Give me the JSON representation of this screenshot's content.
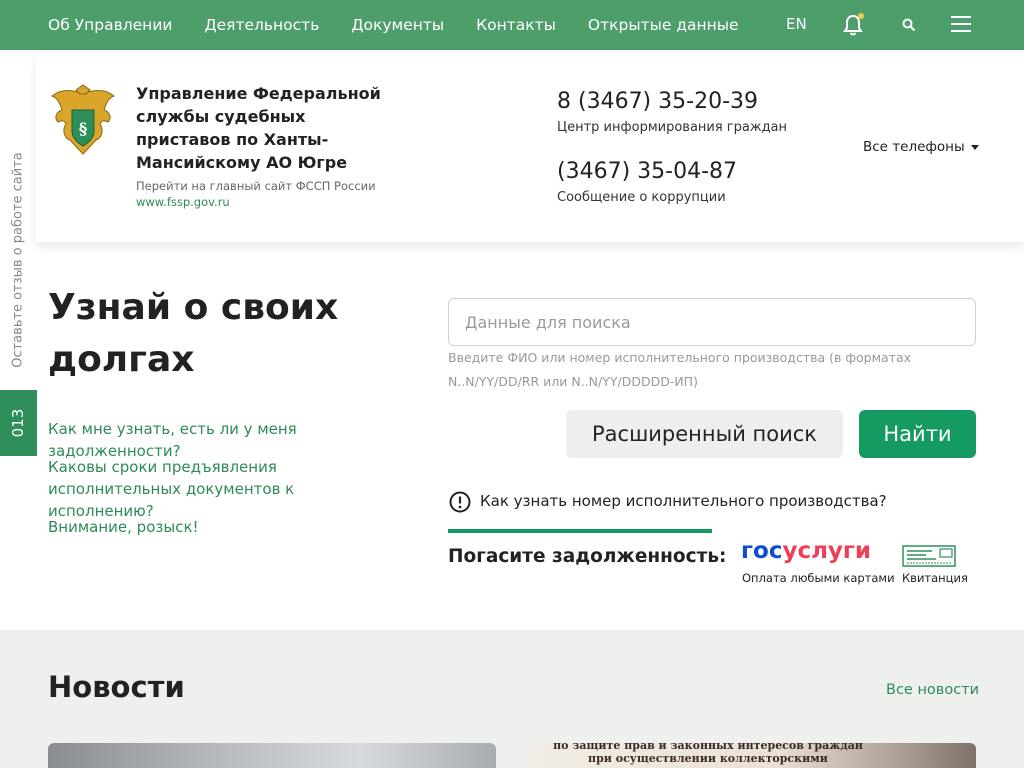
{
  "nav": {
    "items": [
      "Об Управлении",
      "Деятельность",
      "Документы",
      "Контакты",
      "Открытые данные"
    ],
    "lang": "EN",
    "icons": [
      "bell-icon",
      "search-icon",
      "menu-icon"
    ]
  },
  "header": {
    "org_name": "Управление Федеральной службы судебных приставов по Ханты-Мансийскому АО Югре",
    "main_site_label": "Перейти на главный сайт ФССП России",
    "main_site_link": "www.fssp.gov.ru",
    "phone1": "8 (3467) 35-20-39",
    "phone1_label": "Центр информирования граждан",
    "phone2": "(3467) 35-04-87",
    "phone2_label": "Сообщение о коррупции",
    "all_phones": "Все телефоны"
  },
  "side": {
    "feedback": "Оставьте отзыв о работе сайта",
    "badge": "013"
  },
  "debt": {
    "title": "Узнай о своих долгах",
    "faq": [
      "Как мне узнать, есть ли у меня задолженности?",
      "Каковы сроки предъявления исполнительных документов к исполнению?",
      "Внимание, розыск!"
    ],
    "search_placeholder": "Данные для поиска",
    "search_hint": "Введите ФИО или номер исполнительного производства (в форматах N..N/YY/DD/RR или N..N/YY/DDDDD-ИП)",
    "advanced_button": "Расширенный поиск",
    "find_button": "Найти",
    "howto_link": "Как узнать номер исполнительного производства?",
    "pay_label": "Погасите задолженность:",
    "gosuslugi_gos": "гос",
    "gosuslugi_usl": "услуги",
    "gosuslugi_caption": "Оплата любыми картами",
    "receipt_caption": "Квитанция"
  },
  "news": {
    "title": "Новости",
    "all_news": "Все новости",
    "image2_text_line1": "по защите прав и законных интересов граждан",
    "image2_text_line2": "при осуществлении коллекторскими"
  },
  "colors": {
    "nav_bg": "#4e9e6c",
    "accent": "#159a62",
    "link": "#2e8b57",
    "gos_blue": "#0d4cd3",
    "gos_red": "#ee3f58",
    "news_bg": "#eef0ee"
  }
}
